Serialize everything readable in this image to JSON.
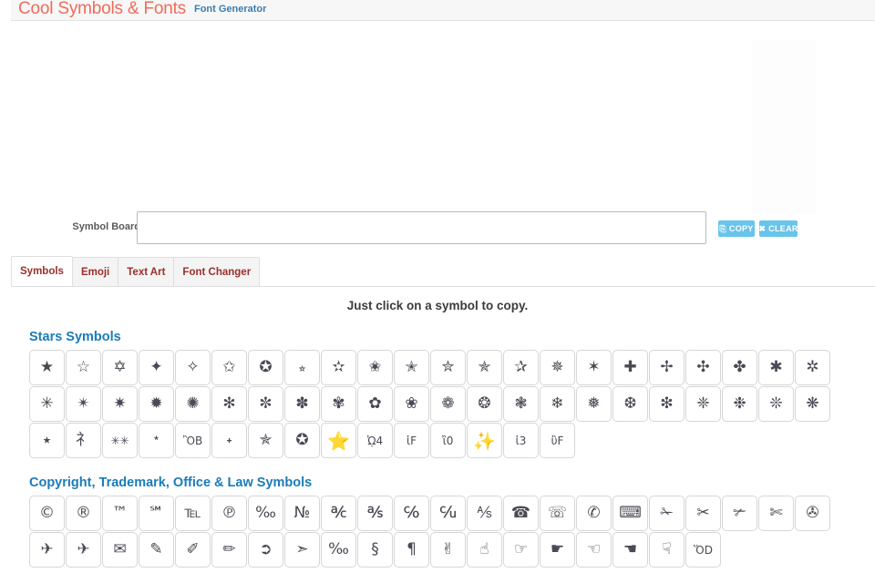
{
  "header": {
    "title": "Cool Symbols & Fonts",
    "subtitle": "Font Generator",
    "brand_color": "#ef6b5a",
    "subtitle_color": "#3b7fb0"
  },
  "board": {
    "label": "Symbol Board",
    "value": "",
    "placeholder": "",
    "copy_label": "COPY",
    "copy_icon": "clipboard-icon",
    "copy_glyph": "⎘",
    "clear_label": "CLEAR",
    "clear_icon": "close-icon",
    "clear_glyph": "✖",
    "button_color": "#68c4ea"
  },
  "tabs": [
    {
      "label": "Symbols",
      "active": true
    },
    {
      "label": "Emoji",
      "active": false
    },
    {
      "label": "Text Art",
      "active": false
    },
    {
      "label": "Font Changer",
      "active": false
    }
  ],
  "instruction": "Just click on a symbol to copy.",
  "sections": [
    {
      "title": "Stars Symbols",
      "title_color": "#1a7bb9",
      "symbols": [
        "★",
        "☆",
        "✡",
        "✦",
        "✧",
        "✩",
        "✪",
        "⭐︎",
        "✫",
        "✬",
        "✭",
        "✮",
        "✯",
        "✰",
        "✵",
        "✶",
        "✚",
        "✢",
        "✣",
        "✤",
        "✱",
        "✲",
        "✳",
        "✴",
        "✷",
        "✹",
        "✺",
        "✻",
        "✼",
        "✽",
        "✾",
        "✿",
        "❀",
        "❁",
        "❂",
        "❃",
        "❄",
        "❅",
        "❆",
        "❇",
        "❈",
        "❉",
        "❊",
        "❋",
        "⭑",
        "⺭",
        "✳✳",
        "﹡",
        "ὊB",
        "˖",
        "✯",
        "✪",
        "⭐",
        "ᾨ4",
        "ἱF",
        "ἲ0",
        "✨",
        "ἰ3",
        "ὒF"
      ]
    },
    {
      "title": "Copyright, Trademark, Office & Law Symbols",
      "title_color": "#1a7bb9",
      "symbols": [
        "©",
        "®",
        "™",
        "℠",
        "℡",
        "℗",
        "‰",
        "№",
        "℀",
        "℁",
        "℅",
        "℆",
        "⅍",
        "☎",
        "☏",
        "✆",
        "⌨",
        "✁",
        "✂",
        "✃",
        "✄",
        "✇",
        "✈",
        "✈",
        "✉",
        "✎",
        "✐",
        "✏",
        "➲",
        "➣",
        "‰",
        "§",
        "¶",
        "✌",
        "☝",
        "☞",
        "☛",
        "☜",
        "☚",
        "☟",
        "ὍD"
      ]
    }
  ]
}
